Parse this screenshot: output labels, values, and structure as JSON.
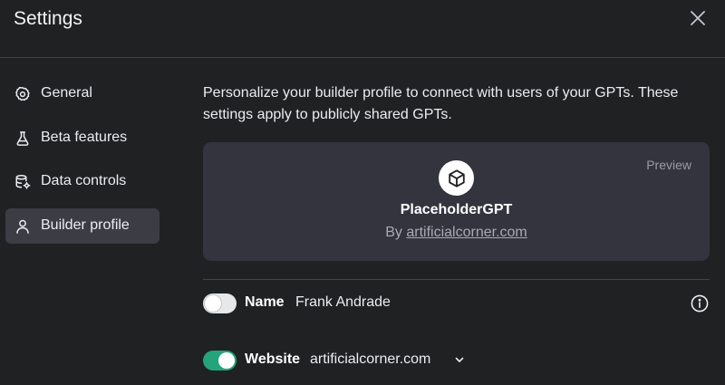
{
  "header": {
    "title": "Settings"
  },
  "sidebar": {
    "items": [
      {
        "label": "General",
        "icon": "gear-icon",
        "active": false
      },
      {
        "label": "Beta features",
        "icon": "flask-icon",
        "active": false
      },
      {
        "label": "Data controls",
        "icon": "database-gear-icon",
        "active": false
      },
      {
        "label": "Builder profile",
        "icon": "user-icon",
        "active": true
      }
    ]
  },
  "main": {
    "description": "Personalize your builder profile to connect with users of your GPTs. These settings apply to publicly shared GPTs.",
    "preview": {
      "tag": "Preview",
      "gpt_name": "PlaceholderGPT",
      "by_prefix": "By ",
      "by_link": "artificialcorner.com"
    },
    "name_row": {
      "label": "Name",
      "value": "Frank Andrade",
      "enabled": false
    },
    "website_row": {
      "label": "Website",
      "value": "artificialcorner.com",
      "enabled": true
    }
  },
  "colors": {
    "background": "#202123",
    "active_nav": "#3c3d44",
    "card": "#33343d",
    "toggle_on": "#24a47a",
    "toggle_off": "#e8e8ea"
  }
}
